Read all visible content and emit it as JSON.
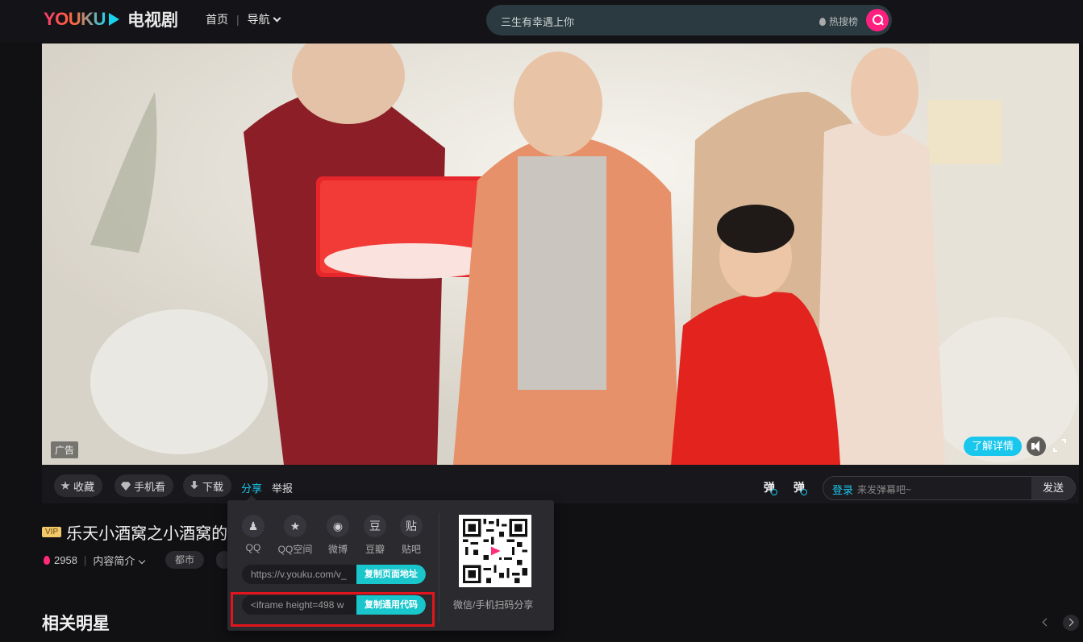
{
  "header": {
    "logo_text": "YOUKU",
    "category": "电视剧",
    "nav_home": "首页",
    "nav_sep": "|",
    "nav_menu": "导航",
    "search_placeholder": "三生有幸遇上你",
    "hot_label": "热搜榜"
  },
  "player": {
    "ad_badge": "广告",
    "learn_more": "了解详情"
  },
  "actions": {
    "collect": "收藏",
    "mobile": "手机看",
    "download": "下载",
    "share": "分享",
    "report": "举报",
    "danmu_icon_1": "弹",
    "danmu_icon_2": "弹",
    "danmu_login": "登录",
    "danmu_placeholder": "来发弹幕吧~",
    "send": "发送"
  },
  "show": {
    "vip": "VIP",
    "title": "乐天小酒窝之小酒窝的",
    "heat": "2958",
    "intro": "内容简介",
    "tag": "都市"
  },
  "section": {
    "title": "相关明星"
  },
  "share_popup": {
    "platforms": [
      {
        "icon": "qq-icon",
        "glyph": "♟",
        "label": "QQ"
      },
      {
        "icon": "qzone-icon",
        "glyph": "★",
        "label": "QQ空间"
      },
      {
        "icon": "weibo-icon",
        "glyph": "◉",
        "label": "微博"
      },
      {
        "icon": "douban-icon",
        "glyph": "豆",
        "label": "豆瓣"
      },
      {
        "icon": "tieba-icon",
        "glyph": "贴",
        "label": "贴吧"
      }
    ],
    "page_url": "https://v.youku.com/v_",
    "copy_url_button": "复制页面地址",
    "embed_code": "<iframe height=498 w",
    "copy_code_button": "复制通用代码",
    "qr_label": "微信/手机扫码分享"
  },
  "colors": {
    "brand_pink": "#ff1f7f",
    "accent_cyan": "#19c6ec",
    "highlight_red": "#e3141c"
  }
}
